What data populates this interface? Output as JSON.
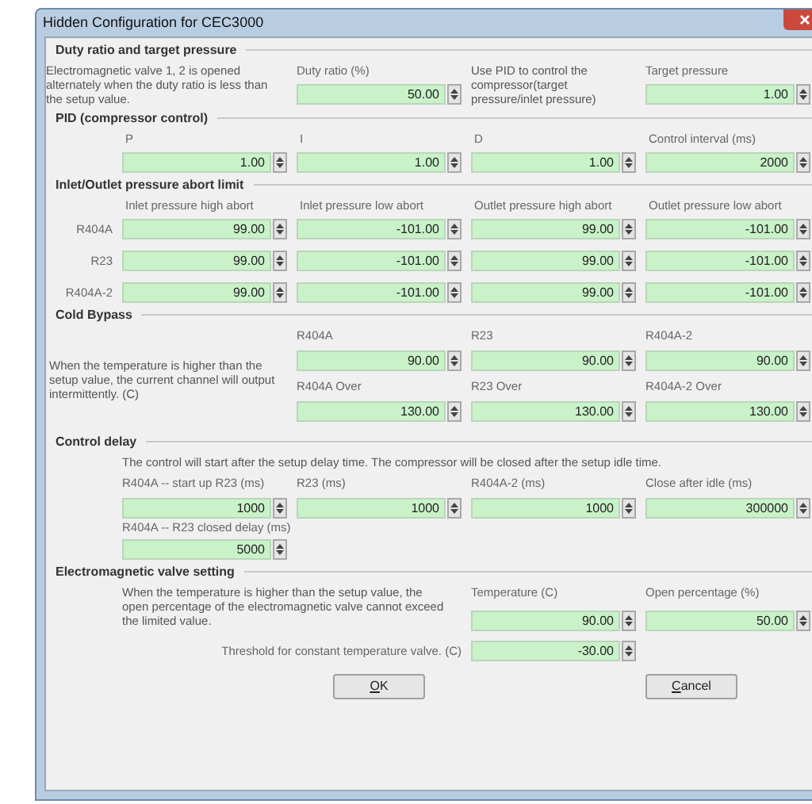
{
  "window": {
    "title": "Hidden Configuration for CEC3000"
  },
  "sections": [
    {
      "kind": "duty",
      "title": "Duty ratio and target pressure",
      "items": [
        {
          "kind": "note",
          "text": "Electromagnetic valve 1, 2 is opened alternately when the duty ratio is less than the setup value."
        },
        {
          "kind": "field",
          "label": "Duty ratio (%)",
          "value": "50.00"
        },
        {
          "kind": "note",
          "text": "Use PID to control the compressor(target pressure/inlet pressure)"
        },
        {
          "kind": "field",
          "label": "Target pressure",
          "value": "1.00"
        }
      ]
    },
    {
      "kind": "pid",
      "title": "PID (compressor control)",
      "fields": [
        {
          "label": "P",
          "value": "1.00"
        },
        {
          "label": "I",
          "value": "1.00"
        },
        {
          "label": "D",
          "value": "1.00"
        },
        {
          "label": "Control interval (ms)",
          "value": "2000"
        }
      ]
    },
    {
      "kind": "abort",
      "title": "Inlet/Outlet pressure abort limit",
      "columns": [
        "Inlet pressure high abort",
        "Inlet pressure low abort",
        "Outlet pressure high abort",
        "Outlet pressure low abort"
      ],
      "rows": [
        {
          "label": "R404A",
          "values": [
            "99.00",
            "-101.00",
            "99.00",
            "-101.00"
          ]
        },
        {
          "label": "R23",
          "values": [
            "99.00",
            "-101.00",
            "99.00",
            "-101.00"
          ]
        },
        {
          "label": "R404A-2",
          "values": [
            "99.00",
            "-101.00",
            "99.00",
            "-101.00"
          ]
        }
      ]
    },
    {
      "kind": "bypass",
      "title": "Cold Bypass",
      "note": "When the temperature is higher than the setup value, the current channel will output intermittently. (C)",
      "groups": [
        [
          {
            "label": "R404A",
            "value": "90.00"
          },
          {
            "label": "R23",
            "value": "90.00"
          },
          {
            "label": "R404A-2",
            "value": "90.00"
          }
        ],
        [
          {
            "label": "R404A Over",
            "value": "130.00"
          },
          {
            "label": "R23 Over",
            "value": "130.00"
          },
          {
            "label": "R404A-2 Over",
            "value": "130.00"
          }
        ]
      ]
    },
    {
      "kind": "delay",
      "title": "Control delay",
      "note": "The control will start after the setup delay time. The compressor will be closed after the setup idle time.",
      "fields": [
        {
          "label": "R404A -- start up R23 (ms)",
          "value": "1000"
        },
        {
          "label": "R23 (ms)",
          "value": "1000"
        },
        {
          "label": "R404A-2 (ms)",
          "value": "1000"
        },
        {
          "label": "Close after idle (ms)",
          "value": "300000"
        },
        {
          "label": "R404A -- R23 closed delay (ms)",
          "value": "5000"
        }
      ]
    },
    {
      "kind": "valve",
      "title": "Electromagnetic valve setting",
      "note": "When the temperature is higher than the setup value, the open percentage of the electromagnetic valve cannot exceed the limited value.",
      "fields": [
        {
          "label": "Temperature (C)",
          "value": "90.00"
        },
        {
          "label": "Open percentage (%)",
          "value": "50.00"
        }
      ],
      "threshold": {
        "label": "Threshold for constant temperature valve. (C)",
        "value": "-30.00"
      }
    }
  ],
  "buttons": [
    {
      "label": "OK"
    },
    {
      "label": "Cancel"
    }
  ]
}
